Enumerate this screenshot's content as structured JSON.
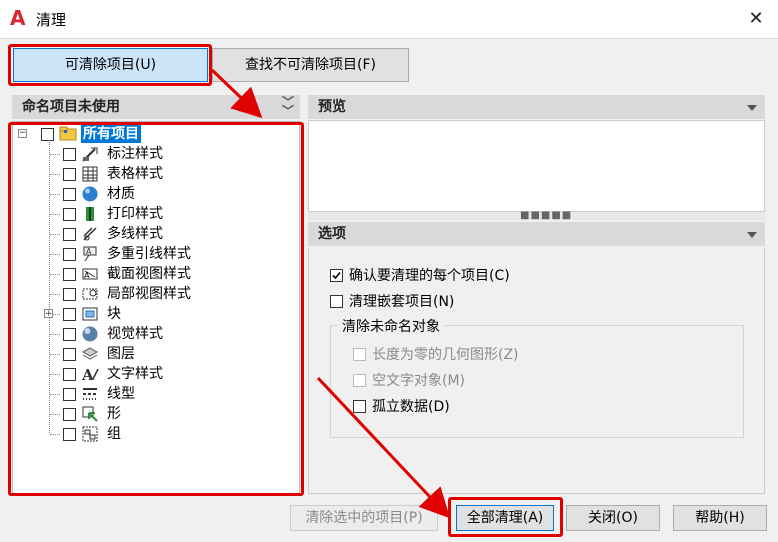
{
  "window": {
    "title": "清理",
    "app_icon": "autocad-icon",
    "close_glyph": "✕"
  },
  "tabs": [
    {
      "label": "可清除项目(U)",
      "active": true
    },
    {
      "label": "查找不可清除项目(F)",
      "active": false
    }
  ],
  "named_panel": {
    "header": "命名项目未使用",
    "collapse_icon": "double-chevron-down-icon"
  },
  "tree": {
    "root": {
      "label": "所有项目",
      "icon": "folder-icon",
      "expanded": true
    },
    "items": [
      {
        "label": "标注样式",
        "icon": "dimension-style-icon"
      },
      {
        "label": "表格样式",
        "icon": "table-style-icon"
      },
      {
        "label": "材质",
        "icon": "material-sphere-icon"
      },
      {
        "label": "打印样式",
        "icon": "plot-style-icon"
      },
      {
        "label": "多线样式",
        "icon": "multiline-style-icon"
      },
      {
        "label": "多重引线样式",
        "icon": "multileader-style-icon"
      },
      {
        "label": "截面视图样式",
        "icon": "section-view-style-icon"
      },
      {
        "label": "局部视图样式",
        "icon": "detail-view-style-icon"
      },
      {
        "label": "块",
        "icon": "block-icon",
        "expandable": true
      },
      {
        "label": "视觉样式",
        "icon": "visual-style-icon"
      },
      {
        "label": "图层",
        "icon": "layers-icon"
      },
      {
        "label": "文字样式",
        "icon": "text-style-icon"
      },
      {
        "label": "线型",
        "icon": "linetype-icon"
      },
      {
        "label": "形",
        "icon": "shape-icon"
      },
      {
        "label": "组",
        "icon": "group-icon"
      }
    ]
  },
  "preview": {
    "header": "预览"
  },
  "options": {
    "header": "选项",
    "confirm_each": {
      "label": "确认要清理的每个项目(C)",
      "checked": true
    },
    "purge_nested": {
      "label": "清理嵌套项目(N)",
      "checked": false
    },
    "unnamed_group": {
      "label": "清除未命名对象",
      "zero_length": {
        "label": "长度为零的几何图形(Z)",
        "checked": false,
        "enabled": false
      },
      "empty_text": {
        "label": "空文字对象(M)",
        "checked": false,
        "enabled": false
      },
      "orphaned_data": {
        "label": "孤立数据(D)",
        "checked": false,
        "enabled": true
      }
    }
  },
  "buttons": {
    "purge_checked": "清除选中的项目(P)",
    "purge_all": "全部清理(A)",
    "close": "关闭(O)",
    "help": "帮助(H)"
  },
  "colors": {
    "annotation_red": "#e00000",
    "accent_blue": "#0078d7",
    "selected_bg": "#0078d7"
  }
}
